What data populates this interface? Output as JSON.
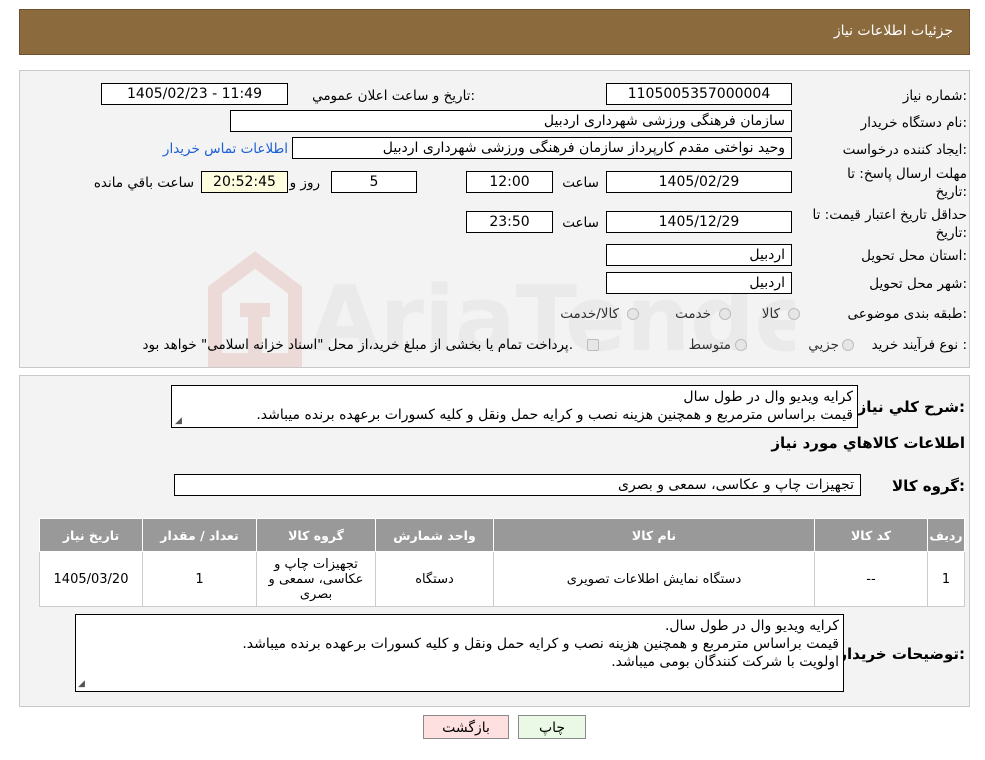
{
  "header": {
    "title": "جزئیات اطلاعات نیاز"
  },
  "watermark": {
    "text": "AriaTender.neT"
  },
  "form": {
    "need_number": {
      "label": "شماره نیاز:",
      "value": "1105005357000004"
    },
    "announce_datetime": {
      "label": "تاریخ و ساعت اعلان عمومي:",
      "value": "1405/02/23 - 11:49"
    },
    "buyer_org": {
      "label": "نام دستگاه خريدار:",
      "value": "سازمان فرهنگی ورزشی شهرداری اردبیل"
    },
    "requester": {
      "label": "ايجاد کننده درخواست:",
      "value": "وحید نواختی مقدم کارپرداز سازمان فرهنگی ورزشی شهرداری اردبیل",
      "contact_link": "اطلاعات تماس خريدار"
    },
    "reply_deadline": {
      "label_line1": "مهلت ارسال پاسخ: تا",
      "label_line2": "تاريخ:",
      "date": "1405/02/29",
      "time_label": "ساعت",
      "time": "12:00",
      "days": "5",
      "days_label": "روز و",
      "remaining": "20:52:45",
      "remaining_label": "ساعت باقي مانده"
    },
    "price_validity": {
      "label_line1": "حداقل تاريخ اعتبار قيمت: تا",
      "label_line2": "تاريخ:",
      "date": "1405/12/29",
      "time_label": "ساعت",
      "time": "23:50"
    },
    "delivery_province": {
      "label": "استان محل تحويل:",
      "value": "اردبیل"
    },
    "delivery_city": {
      "label": "شهر محل تحويل:",
      "value": "اردبیل"
    },
    "category": {
      "label": "طبقه بندی موضوعی:",
      "options": [
        "کالا",
        "خدمت",
        "کالا/خدمت"
      ]
    },
    "purchase_type": {
      "label": "نوع فرآيند خريد :",
      "options": [
        "جزيي",
        "متوسط"
      ],
      "note": "پرداخت تمام يا بخشی از مبلغ خريد،از محل \"اسناد خزانه اسلامی\" خواهد بود."
    }
  },
  "summary": {
    "label": "شرح کلي نياز:",
    "text": "کرایه ویدیو وال در طول سال\nقیمت براساس مترمربع و همچنین هزینه نصب و کرایه حمل ونقل و کلیه کسورات برعهده برنده میباشد."
  },
  "goods_info_title": "اطلاعات کالاهاي مورد نياز",
  "goods_group": {
    "label": "گروه کالا:",
    "value": "تجهیزات چاپ و عکاسی، سمعی و بصری"
  },
  "table": {
    "headers": [
      "رديف",
      "کد کالا",
      "نام کالا",
      "واحد شمارش",
      "گروه کالا",
      "تعداد / مقدار",
      "تاريخ نياز"
    ],
    "rows": [
      [
        "1",
        "--",
        "دستگاه نمایش اطلاعات تصویری",
        "دستگاه",
        "تجهیزات چاپ و عکاسی، سمعی و بصری",
        "1",
        "1405/03/20"
      ]
    ]
  },
  "buyer_notes": {
    "label": "توضيحات خريدار:",
    "text": "کرایه ویدیو وال در طول سال.\nقیمت براساس مترمربع و همچنین هزینه نصب و کرایه حمل ونقل و کلیه کسورات برعهده برنده میباشد.\nاولویت با شرکت کنندگان بومی میباشد."
  },
  "buttons": {
    "back": "بازگشت",
    "print": "چاپ"
  },
  "colors": {
    "header_bg": "#8B6A3E",
    "table_header_bg": "#999999",
    "back_button_bg": "#FFE0E0",
    "print_button_bg": "#EAF8E6",
    "link": "#1a5fd6"
  }
}
